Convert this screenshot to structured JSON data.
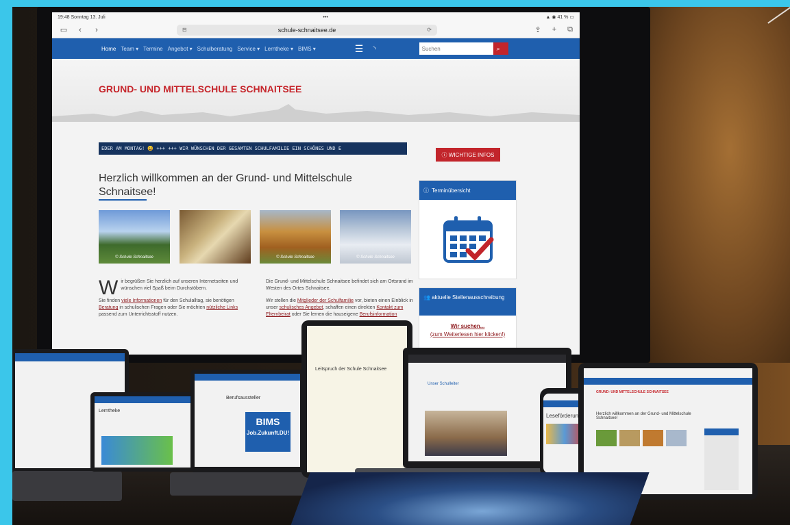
{
  "status": {
    "time": "19:48",
    "date": "Sonntag 13. Juli",
    "dots": "•••",
    "battery": "41 %"
  },
  "browser": {
    "url": "schule-schnaitsee.de"
  },
  "nav": {
    "items": [
      "Home",
      "Team ▾",
      "Termine",
      "Angebot ▾",
      "Schulberatung",
      "Service ▾",
      "Lerntheke ▾",
      "BIMS ▾"
    ],
    "search_placeholder": "Suchen"
  },
  "site": {
    "title": "GRUND- UND MITTELSCHULE SCHNAITSEE",
    "ticker": "EDER AM MONTAG! 😀 +++      +++ WIR WÜNSCHEN DER GESAMTEN SCHULFAMILIE EIN SCHÖNES UND E",
    "important_button": "WICHTIGE INFOS",
    "welcome": "Herzlich willkommen an der Grund- und Mittelschule Schnaitsee!",
    "photo_caption": "© Schule Schnaitsee"
  },
  "text_left": {
    "dropcap": "W",
    "p1": "ir begrüßen Sie herzlich auf unseren Internetseiten und wünschen viel Spaß beim Durchstöbern.",
    "p2a": "Sie finden ",
    "p2_link1": "viele Informationen",
    "p2b": " für den Schulalltag, sie benötigen ",
    "p2_link2": "Beratung",
    "p2c": " in schulischen Fragen oder Sie möchten ",
    "p2_link3": "nützliche Links",
    "p2d": " passend zum Unterrichtsstoff nutzen."
  },
  "text_right": {
    "p1": "Die Grund- und Mittelschule Schnaitsee befindet sich am Ortsrand im Westen des Ortes Schnaitsee.",
    "p2a": "Wir stellen die ",
    "p2_link1": "Mitglieder der Schulfamilie",
    "p2b": " vor, bieten einen Einblick in unser ",
    "p2_link2": "schulisches Angebot",
    "p2c": ", schaffen einen direkten ",
    "p2_link3": "Kontakt zum Elternbeirat",
    "p2d": " oder Sie lernen die hauseigene ",
    "p2_link4": "Berufsinformation"
  },
  "sidebar": {
    "termine_title": "Terminübersicht",
    "stellen_title": "aktuelle Stellenausschreibung",
    "stellen_link1": "Wir suchen...",
    "stellen_link2": "(zum Weiterlesen hier klicken!)"
  },
  "devices": {
    "tablet_small_title": "Lerntheke",
    "laptop_title": "Berufsaussteller",
    "bims_logo": "BIMS",
    "bims_tagline": "Job.Zukunft.DU!",
    "tablet_center_title": "Leitspruch der Schule Schnaitsee",
    "laptop_right_title": "Unser Schulleiter",
    "phone_title": "Leseförderung",
    "tablet_right_title": "GRUND- UND MITTELSCHULE SCHNAITSEE",
    "tablet_right_welcome": "Herzlich willkommen an der Grund- und Mittelschule Schnaitsee!"
  },
  "colors": {
    "brand_blue": "#1f5fae",
    "brand_red": "#c2252b",
    "frame_cyan": "#3bc6ea"
  }
}
